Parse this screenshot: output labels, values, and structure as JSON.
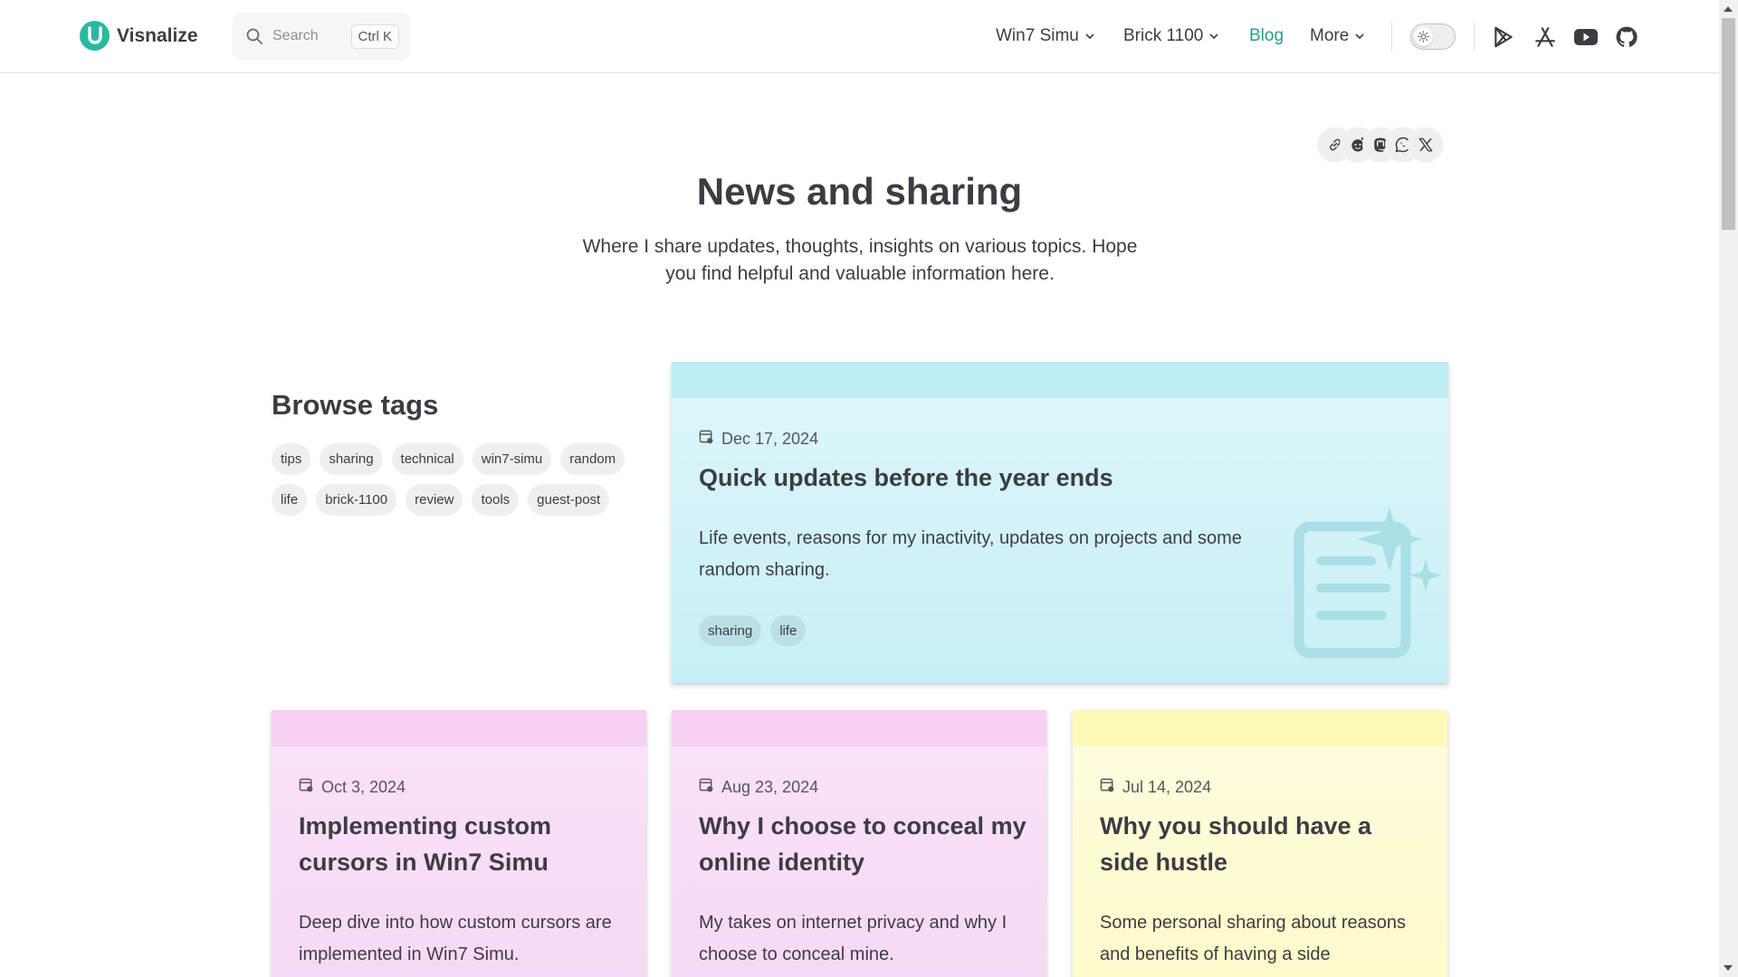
{
  "header": {
    "brand": "Visnalize",
    "search_placeholder": "Search",
    "search_shortcut": "Ctrl K",
    "nav": {
      "win7": "Win7 Simu",
      "brick": "Brick 1100",
      "blog": "Blog",
      "more": "More"
    },
    "social_icons": [
      "google-play-icon",
      "app-store-icon",
      "youtube-icon",
      "github-icon"
    ]
  },
  "share": [
    "link-icon",
    "reddit-icon",
    "mastodon-icon",
    "whatsapp-icon",
    "x-icon"
  ],
  "hero": {
    "title": "News and sharing",
    "subtitle": "Where I share updates, thoughts, insights on various topics. Hope you find helpful and valuable information here."
  },
  "tags": {
    "title": "Browse tags",
    "items": [
      "tips",
      "sharing",
      "technical",
      "win7-simu",
      "random",
      "life",
      "brick-1100",
      "review",
      "tools",
      "guest-post"
    ]
  },
  "featured": {
    "date": "Dec 17, 2024",
    "title": "Quick updates before the year ends",
    "desc": "Life events, reasons for my inactivity, updates on projects and some random sharing.",
    "tags": [
      "sharing",
      "life"
    ]
  },
  "posts": [
    {
      "date": "Oct 3, 2024",
      "title": "Implementing custom cursors in Win7 Simu",
      "desc": "Deep dive into how custom cursors are implemented in Win7 Simu."
    },
    {
      "date": "Aug 23, 2024",
      "title": "Why I choose to conceal my online identity",
      "desc": "My takes on internet privacy and why I choose to conceal mine."
    },
    {
      "date": "Jul 14, 2024",
      "title": "Why you should have a side hustle",
      "desc": "Some personal sharing about reasons and benefits of having a side"
    }
  ],
  "colors": {
    "accent": "#2a9d8a",
    "featured_bg": "#c8f1f6",
    "pink_bg": "#f8dff6",
    "yellow_bg": "#fdfbd0"
  }
}
